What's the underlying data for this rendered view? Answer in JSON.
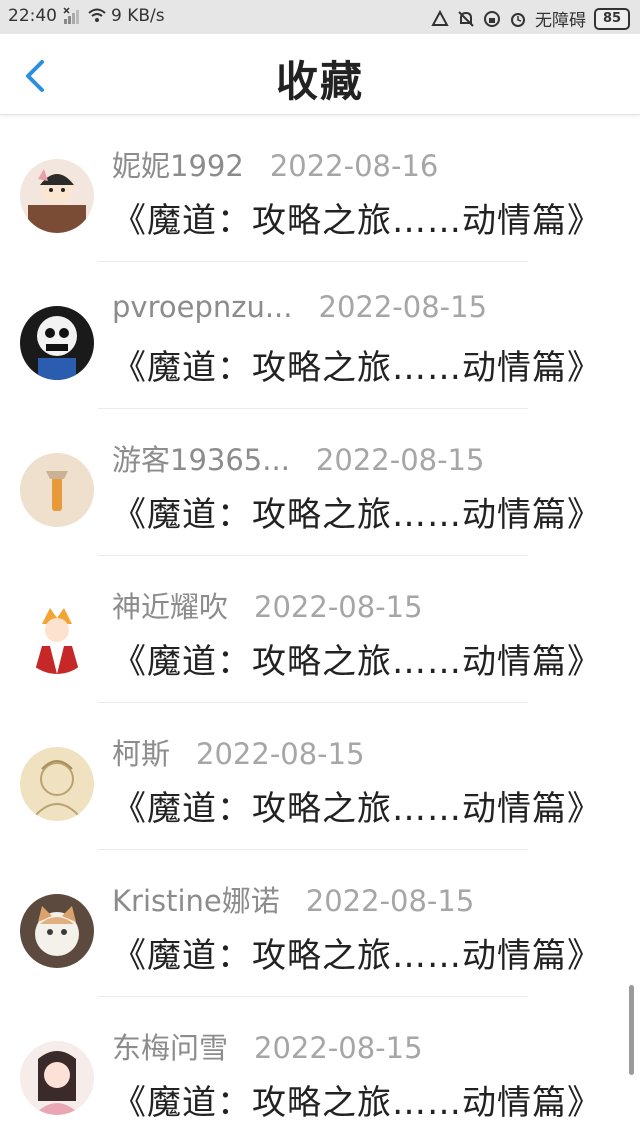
{
  "status_bar": {
    "time": "22:40",
    "net_speed": "9 KB/s",
    "accessibility": "无障碍",
    "battery": "85"
  },
  "header": {
    "title": "收藏",
    "back_icon": "chevron-left-icon",
    "accent": "#2a8fe0"
  },
  "favorites": [
    {
      "user": "妮妮1992",
      "date": "2022-08-16",
      "book": "《魔道：攻略之旅……动情篇》"
    },
    {
      "user": "pvroepnzu...",
      "date": "2022-08-15",
      "book": "《魔道：攻略之旅……动情篇》"
    },
    {
      "user": "游客19365...",
      "date": "2022-08-15",
      "book": "《魔道：攻略之旅……动情篇》"
    },
    {
      "user": "神近耀吹",
      "date": "2022-08-15",
      "book": "《魔道：攻略之旅……动情篇》"
    },
    {
      "user": "柯斯",
      "date": "2022-08-15",
      "book": "《魔道：攻略之旅……动情篇》"
    },
    {
      "user": "Kristine娜诺",
      "date": "2022-08-15",
      "book": "《魔道：攻略之旅……动情篇》"
    },
    {
      "user": "东梅问雪",
      "date": "2022-08-15",
      "book": "《魔道：攻略之旅……动情篇》"
    }
  ]
}
